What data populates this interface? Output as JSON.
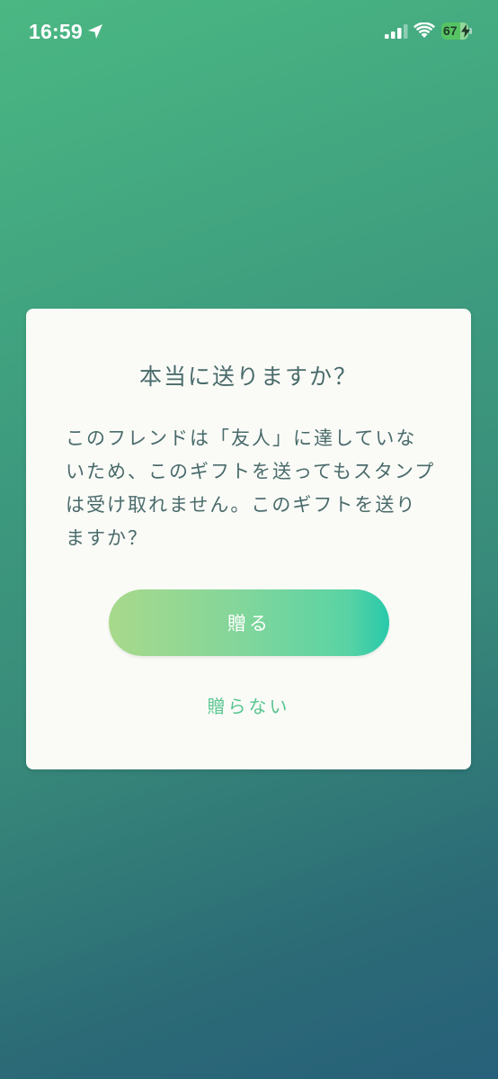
{
  "status_bar": {
    "time": "16:59",
    "battery_level": "67",
    "icons": [
      "location-arrow-icon",
      "cellular-signal-icon",
      "wifi-icon",
      "battery-icon",
      "charging-bolt-icon"
    ]
  },
  "dialog": {
    "title": "本当に送りますか？",
    "message": "このフレンドは「友人」に達していないため、このギフトを送ってもスタンプは受け取れません。このギフトを送りますか？",
    "confirm_label": "贈る",
    "cancel_label": "贈らない"
  },
  "colors": {
    "background_top": "#4bb883",
    "background_bottom": "#27607a",
    "dialog_bg": "#fafbf7",
    "text": "#4a6b6b",
    "button_start": "#a8d98b",
    "button_end": "#27c9aa",
    "cancel_text": "#58c58f",
    "battery": "#56c463"
  }
}
